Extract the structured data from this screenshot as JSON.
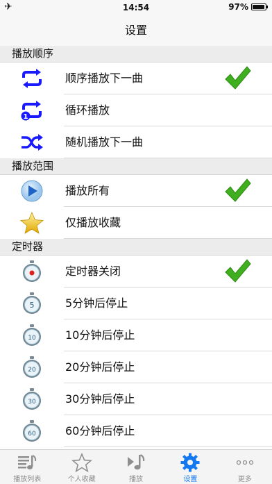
{
  "status": {
    "time": "14:54",
    "battery": "97%",
    "battery_level": 0.97
  },
  "nav": {
    "title": "设置"
  },
  "sections": [
    {
      "header": "播放顺序",
      "rows": [
        {
          "label": "顺序播放下一曲",
          "icon": "repeat-icon",
          "checked": true
        },
        {
          "label": "循环播放",
          "icon": "repeat-one-icon",
          "checked": false
        },
        {
          "label": "随机播放下一曲",
          "icon": "shuffle-icon",
          "checked": false
        }
      ]
    },
    {
      "header": "播放范围",
      "rows": [
        {
          "label": "播放所有",
          "icon": "play-circle-icon",
          "checked": true
        },
        {
          "label": "仅播放收藏",
          "icon": "star-icon",
          "checked": false
        }
      ]
    },
    {
      "header": "定时器",
      "rows": [
        {
          "label": "定时器关闭",
          "icon": "timer-off-icon",
          "checked": true,
          "timer": ""
        },
        {
          "label": "5分钟后停止",
          "icon": "timer-5-icon",
          "checked": false,
          "timer": "5"
        },
        {
          "label": "10分钟后停止",
          "icon": "timer-10-icon",
          "checked": false,
          "timer": "10"
        },
        {
          "label": "20分钟后停止",
          "icon": "timer-20-icon",
          "checked": false,
          "timer": "20"
        },
        {
          "label": "30分钟后停止",
          "icon": "timer-30-icon",
          "checked": false,
          "timer": "30"
        },
        {
          "label": "60分钟后停止",
          "icon": "timer-60-icon",
          "checked": false,
          "timer": "60"
        }
      ]
    }
  ],
  "tabs": [
    {
      "label": "播放列表",
      "icon": "playlist-icon",
      "active": false
    },
    {
      "label": "个人收藏",
      "icon": "star-outline-icon",
      "active": false
    },
    {
      "label": "播放",
      "icon": "music-note-icon",
      "active": false
    },
    {
      "label": "设置",
      "icon": "gear-icon",
      "active": true
    },
    {
      "label": "更多",
      "icon": "more-dots-icon",
      "active": false
    }
  ],
  "colors": {
    "accent": "#1478f0",
    "check_green": "#3fae1f",
    "icon_blue": "#1a1aff"
  }
}
